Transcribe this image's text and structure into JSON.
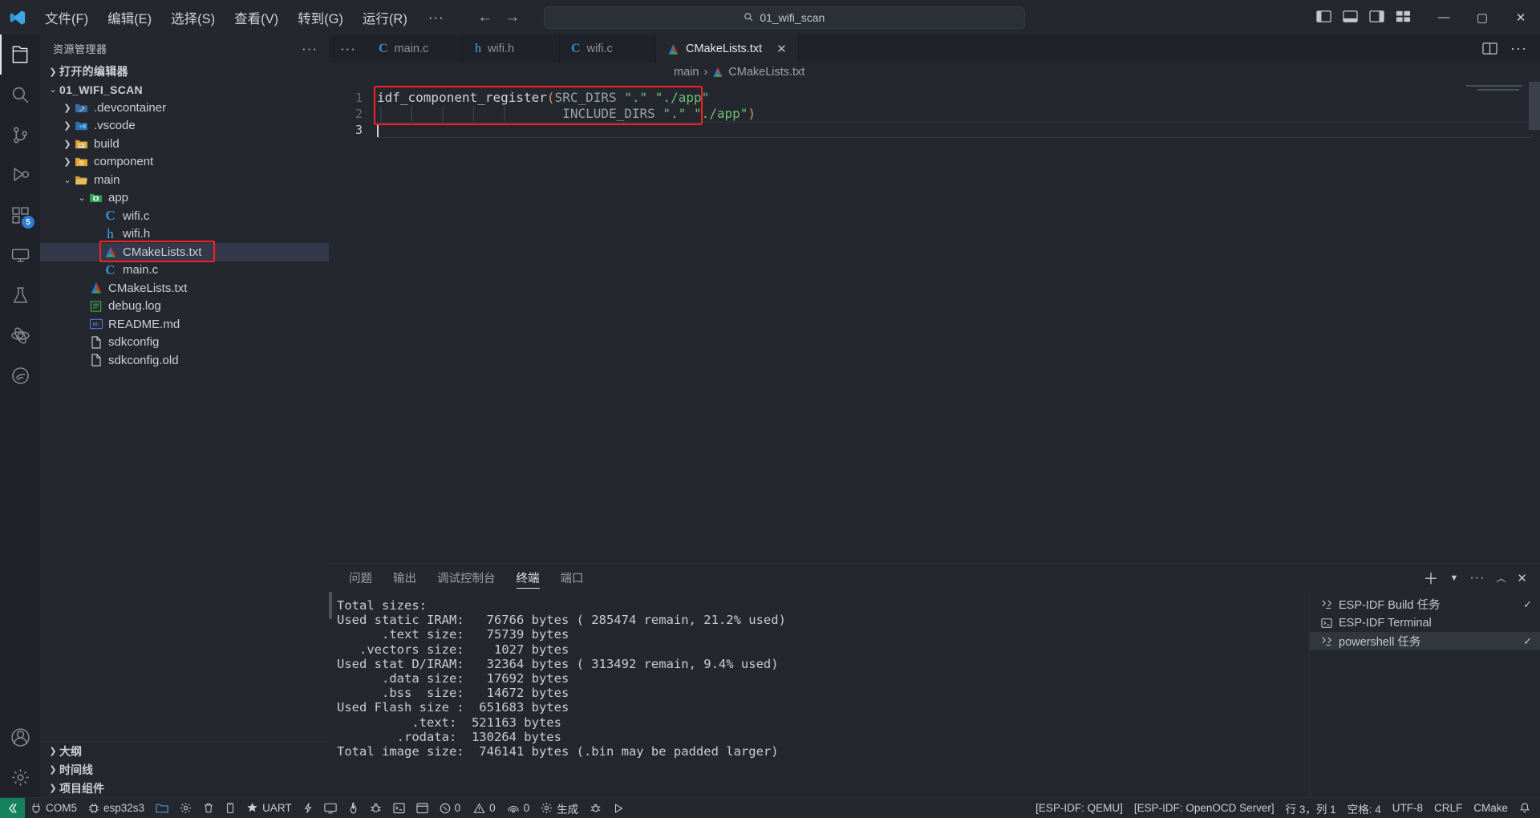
{
  "window": {
    "title": "01_wifi_scan",
    "search_placeholder": "01_wifi_scan"
  },
  "titlebar": {
    "logo": "vscode-logo",
    "menus": [
      {
        "label": "文件(F)"
      },
      {
        "label": "编辑(E)"
      },
      {
        "label": "选择(S)"
      },
      {
        "label": "查看(V)"
      },
      {
        "label": "转到(G)"
      },
      {
        "label": "运行(R)"
      }
    ],
    "overflow": "···",
    "nav_back": "←",
    "nav_forward": "→",
    "layout_icons": [
      "toggle-primary-sidebar",
      "toggle-panel",
      "toggle-secondary-sidebar",
      "customize-layout"
    ],
    "window_controls": {
      "minimize": "—",
      "maximize": "▢",
      "close": "✕"
    }
  },
  "activitybar": {
    "items": [
      {
        "name": "explorer",
        "active": true
      },
      {
        "name": "search",
        "active": false
      },
      {
        "name": "source-control",
        "active": false
      },
      {
        "name": "run-and-debug",
        "active": false
      },
      {
        "name": "extensions",
        "active": false,
        "badge": "5"
      },
      {
        "name": "remote-explorer",
        "active": false
      },
      {
        "name": "testing",
        "active": false
      },
      {
        "name": "esp-idf-explorer",
        "active": false
      },
      {
        "name": "espressif",
        "active": false
      }
    ],
    "bottom": [
      {
        "name": "accounts"
      },
      {
        "name": "manage-settings"
      }
    ]
  },
  "sidebar": {
    "title": "资源管理器",
    "more_actions": "···",
    "tree": [
      {
        "label": "打开的编辑器",
        "indent": 0,
        "chev": "collapsed",
        "icon": "none",
        "bold": true
      },
      {
        "label": "01_WIFI_SCAN",
        "indent": 0,
        "chev": "expanded",
        "icon": "none",
        "bold": true
      },
      {
        "label": ".devcontainer",
        "indent": 1,
        "chev": "collapsed",
        "icon": "folder-devcontainer"
      },
      {
        "label": ".vscode",
        "indent": 1,
        "chev": "collapsed",
        "icon": "folder-vscode"
      },
      {
        "label": "build",
        "indent": 1,
        "chev": "collapsed",
        "icon": "folder-build"
      },
      {
        "label": "component",
        "indent": 1,
        "chev": "collapsed",
        "icon": "folder-component"
      },
      {
        "label": "main",
        "indent": 1,
        "chev": "expanded",
        "icon": "folder-open"
      },
      {
        "label": "app",
        "indent": 2,
        "chev": "expanded",
        "icon": "folder-app"
      },
      {
        "label": "wifi.c",
        "indent": 3,
        "chev": "none",
        "icon": "c-file"
      },
      {
        "label": "wifi.h",
        "indent": 3,
        "chev": "none",
        "icon": "h-file"
      },
      {
        "label": "CMakeLists.txt",
        "indent": 3,
        "chev": "none",
        "icon": "cmake-file",
        "selected": true,
        "annotated": true
      },
      {
        "label": "main.c",
        "indent": 3,
        "chev": "none",
        "icon": "c-file"
      },
      {
        "label": "CMakeLists.txt",
        "indent": 2,
        "chev": "none",
        "icon": "cmake-file"
      },
      {
        "label": "debug.log",
        "indent": 2,
        "chev": "none",
        "icon": "log-file"
      },
      {
        "label": "README.md",
        "indent": 2,
        "chev": "none",
        "icon": "md-file"
      },
      {
        "label": "sdkconfig",
        "indent": 2,
        "chev": "none",
        "icon": "plain-file"
      },
      {
        "label": "sdkconfig.old",
        "indent": 2,
        "chev": "none",
        "icon": "plain-file"
      }
    ],
    "footer": [
      {
        "label": "大纲"
      },
      {
        "label": "时间线"
      },
      {
        "label": "项目组件"
      }
    ]
  },
  "editor": {
    "tabs": [
      {
        "label": "main.c",
        "icon": "c-file",
        "active": false
      },
      {
        "label": "wifi.h",
        "icon": "h-file",
        "active": false
      },
      {
        "label": "wifi.c",
        "icon": "c-file",
        "active": false
      },
      {
        "label": "CMakeLists.txt",
        "icon": "cmake-file",
        "active": true,
        "close": "✕"
      }
    ],
    "tabs_overflow": "···",
    "tabs_right_icons": [
      "split-editor",
      "editor-actions-more"
    ],
    "breadcrumb": [
      {
        "label": "main",
        "icon": "none"
      },
      {
        "label": "CMakeLists.txt",
        "icon": "cmake-file"
      }
    ],
    "breadcrumb_sep": "›",
    "lines": [
      {
        "no": "1",
        "segments": [
          {
            "t": "idf_component_register",
            "c": "fn"
          },
          {
            "t": "(",
            "c": "paren"
          },
          {
            "t": "SRC_DIRS ",
            "c": "arg"
          },
          {
            "t": "\".",
            "c": "str"
          },
          {
            "t": "\" ",
            "c": "str"
          },
          {
            "t": "\"./app\"",
            "c": "str"
          }
        ]
      },
      {
        "no": "2",
        "segments": [
          {
            "t": "                    ",
            "c": "indent"
          },
          {
            "t": "INCLUDE_DIRS ",
            "c": "arg"
          },
          {
            "t": "\".\" ",
            "c": "str"
          },
          {
            "t": "\"./app\"",
            "c": "str"
          },
          {
            "t": ")",
            "c": "paren"
          }
        ]
      },
      {
        "no": "3",
        "segments": []
      }
    ]
  },
  "panel": {
    "tabs": [
      {
        "label": "问题",
        "active": false
      },
      {
        "label": "输出",
        "active": false
      },
      {
        "label": "调试控制台",
        "active": false
      },
      {
        "label": "终端",
        "active": true
      },
      {
        "label": "端口",
        "active": false
      }
    ],
    "actions": [
      "new-terminal-icon",
      "terminal-profile-chevron-icon",
      "panel-more-icon",
      "maximize-panel-icon",
      "close-panel-icon"
    ],
    "terminal_lines": [
      "Total sizes:",
      "Used static IRAM:   76766 bytes ( 285474 remain, 21.2% used)",
      "      .text size:   75739 bytes",
      "   .vectors size:    1027 bytes",
      "Used stat D/IRAM:   32364 bytes ( 313492 remain, 9.4% used)",
      "      .data size:   17692 bytes",
      "      .bss  size:   14672 bytes",
      "Used Flash size :  651683 bytes",
      "          .text:  521163 bytes",
      "        .rodata:  130264 bytes",
      "Total image size:  746141 bytes (.bin may be padded larger)"
    ],
    "terminal_list": [
      {
        "label": "ESP-IDF Build 任务",
        "icon": "tasks-icon",
        "active": false,
        "check": "✓"
      },
      {
        "label": "ESP-IDF Terminal",
        "icon": "terminal-icon",
        "active": false,
        "check": ""
      },
      {
        "label": "powershell 任务",
        "icon": "tasks-icon",
        "active": true,
        "check": "✓"
      }
    ]
  },
  "statusbar": {
    "remote_label": "",
    "left": [
      {
        "label": "COM5",
        "icon": "plug-icon"
      },
      {
        "label": "esp32s3",
        "icon": "chip-icon"
      },
      {
        "label": "",
        "icon": "folder-open-icon"
      },
      {
        "label": "",
        "icon": "gear-icon"
      },
      {
        "label": "",
        "icon": "trash-icon"
      },
      {
        "label": "",
        "icon": "device-icon"
      },
      {
        "label": "UART",
        "icon": "star-icon"
      },
      {
        "label": "",
        "icon": "flash-icon"
      },
      {
        "label": "",
        "icon": "monitor-icon"
      },
      {
        "label": "",
        "icon": "flame-icon"
      },
      {
        "label": "",
        "icon": "debug-icon"
      },
      {
        "label": "",
        "icon": "terminal-icon"
      },
      {
        "label": "",
        "icon": "window-icon"
      },
      {
        "label": "0",
        "icon": "error-icon"
      },
      {
        "label": "0",
        "icon": "warning-icon"
      },
      {
        "label": "0",
        "icon": "radar-icon"
      },
      {
        "label": "生成",
        "icon": "gear-icon"
      },
      {
        "label": "",
        "icon": "bug-icon"
      },
      {
        "label": "",
        "icon": "play-icon"
      }
    ],
    "right": [
      {
        "label": "[ESP-IDF: QEMU]"
      },
      {
        "label": "[ESP-IDF: OpenOCD Server]"
      },
      {
        "label": "行 3，列 1"
      },
      {
        "label": "空格: 4"
      },
      {
        "label": "UTF-8"
      },
      {
        "label": "CRLF"
      },
      {
        "label": "CMake"
      },
      {
        "label": "",
        "icon": "bell-icon"
      }
    ]
  },
  "annotation": {
    "arrow_color": "#ff2020",
    "box_color": "#ff2020"
  },
  "colors": {
    "accent": "#2f7cd6",
    "remote_green": "#16825d",
    "bg": "#24272e",
    "bg_dark": "#1f2228"
  }
}
